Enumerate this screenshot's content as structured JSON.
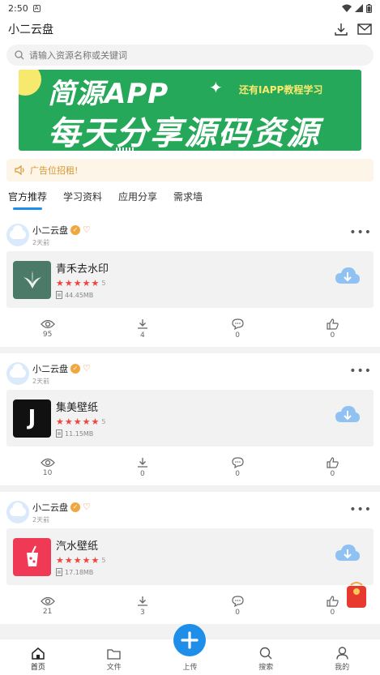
{
  "status": {
    "time": "2:50"
  },
  "header": {
    "title": "小二云盘"
  },
  "search": {
    "placeholder": "请输入资源名称或关键词"
  },
  "banner": {
    "line1": "简源APP",
    "line2": "每天分享源码资源",
    "sub": "还有IAPP教程学习"
  },
  "ad": {
    "text": "广告位招租!"
  },
  "tabs": [
    {
      "label": "官方推荐",
      "active": true
    },
    {
      "label": "学习资料"
    },
    {
      "label": "应用分享"
    },
    {
      "label": "需求墙"
    }
  ],
  "posts": [
    {
      "user": "小二云盘",
      "time": "2天前",
      "app": {
        "name": "青禾去水印",
        "rating": "5",
        "size": "44.45MB",
        "icon_color": "#4c7a68"
      },
      "stats": {
        "views": "95",
        "downloads": "4",
        "comments": "0",
        "likes": "0"
      }
    },
    {
      "user": "小二云盘",
      "time": "2天前",
      "app": {
        "name": "集美壁纸",
        "rating": "5",
        "size": "11.15MB",
        "icon_color": "#111111"
      },
      "stats": {
        "views": "10",
        "downloads": "0",
        "comments": "0",
        "likes": "0"
      }
    },
    {
      "user": "小二云盘",
      "time": "2天前",
      "app": {
        "name": "汽水壁纸",
        "rating": "5",
        "size": "17.18MB",
        "icon_color": "#f03a55"
      },
      "stats": {
        "views": "21",
        "downloads": "3",
        "comments": "0",
        "likes": "0"
      }
    }
  ],
  "nav": [
    {
      "label": "首页",
      "icon": "home-icon"
    },
    {
      "label": "文件",
      "icon": "folder-icon"
    },
    {
      "label": "上传",
      "icon": "plus-icon"
    },
    {
      "label": "搜索",
      "icon": "search-icon"
    },
    {
      "label": "我的",
      "icon": "user-icon"
    }
  ],
  "colors": {
    "accent": "#1e8ee8",
    "star": "#f0443c",
    "banner": "#26a85a",
    "ad_text": "#d9962c"
  },
  "redpacket": {
    "text": "红包"
  }
}
